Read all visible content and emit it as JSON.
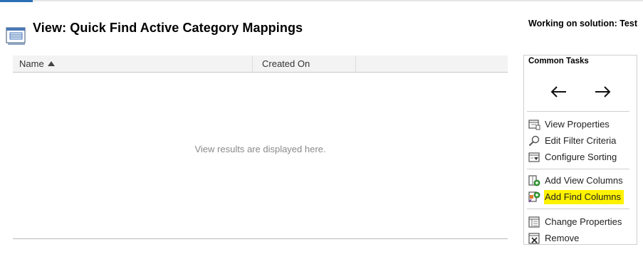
{
  "header": {
    "title": "View: Quick Find Active Category Mappings",
    "solution_text": "Working on solution: Test"
  },
  "grid": {
    "columns": [
      {
        "label": "Name",
        "sorted": "ascending"
      },
      {
        "label": "Created On"
      }
    ],
    "empty_message": "View results are displayed here."
  },
  "common_tasks": {
    "title": "Common Tasks",
    "nav_icons": [
      "back-arrow-icon",
      "forward-arrow-icon"
    ],
    "groups": [
      [
        {
          "label": "View Properties",
          "icon": "view-properties-icon"
        },
        {
          "label": "Edit Filter Criteria",
          "icon": "edit-filter-icon"
        },
        {
          "label": "Configure Sorting",
          "icon": "configure-sorting-icon"
        }
      ],
      [
        {
          "label": "Add View Columns",
          "icon": "add-view-columns-icon"
        },
        {
          "label": "Add Find Columns",
          "icon": "add-find-columns-icon",
          "highlighted": true
        }
      ],
      [
        {
          "label": "Change Properties",
          "icon": "change-properties-icon"
        },
        {
          "label": "Remove",
          "icon": "remove-icon"
        }
      ]
    ],
    "highlight_color": "#fff200"
  }
}
